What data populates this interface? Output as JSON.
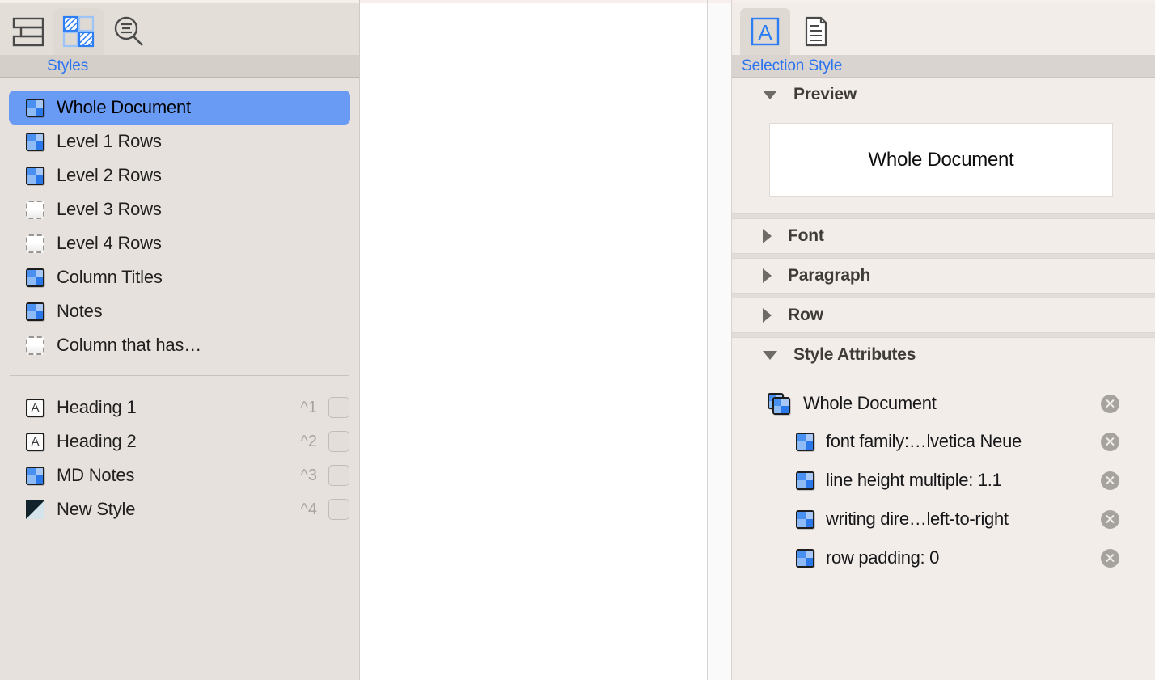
{
  "left_panel": {
    "toolbar": [
      {
        "icon": "table-layout-icon",
        "name": "layout-tab",
        "active": false
      },
      {
        "icon": "styles-checkerboard-icon",
        "name": "styles-tab",
        "active": true
      },
      {
        "icon": "search-document-icon",
        "name": "search-tab",
        "active": false
      }
    ],
    "tab_label": "Styles",
    "styles": [
      {
        "label": "Whole Document",
        "icon": "checkerboard-icon",
        "selected": true
      },
      {
        "label": "Level 1 Rows",
        "icon": "checkerboard-icon",
        "selected": false
      },
      {
        "label": "Level 2 Rows",
        "icon": "checkerboard-icon",
        "selected": false
      },
      {
        "label": "Level 3 Rows",
        "icon": "dashed-empty-icon",
        "selected": false
      },
      {
        "label": "Level 4 Rows",
        "icon": "dashed-empty-icon",
        "selected": false
      },
      {
        "label": "Column Titles",
        "icon": "checkerboard-icon",
        "selected": false
      },
      {
        "label": "Notes",
        "icon": "checkerboard-icon",
        "selected": false
      },
      {
        "label": "Column that has…",
        "icon": "dashed-empty-icon",
        "selected": false
      }
    ],
    "shortcuts": [
      {
        "label": "Heading 1",
        "key": "^1",
        "icon": "letter-a-icon"
      },
      {
        "label": "Heading 2",
        "key": "^2",
        "icon": "letter-a-icon"
      },
      {
        "label": "MD Notes",
        "key": "^3",
        "icon": "checkerboard-icon"
      },
      {
        "label": "New Style",
        "key": "^4",
        "icon": "diagonal-split-icon"
      }
    ]
  },
  "right_panel": {
    "toolbar": [
      {
        "icon": "letter-a-boxed-icon",
        "name": "selection-style-tab",
        "active": true
      },
      {
        "icon": "document-text-icon",
        "name": "document-style-tab",
        "active": false
      }
    ],
    "tab_label": "Selection Style",
    "sections": [
      {
        "title": "Preview",
        "expanded": true
      },
      {
        "title": "Font",
        "expanded": false
      },
      {
        "title": "Paragraph",
        "expanded": false
      },
      {
        "title": "Row",
        "expanded": false
      },
      {
        "title": "Style Attributes",
        "expanded": true
      }
    ],
    "preview_text": "Whole Document",
    "style_attributes": {
      "root_label": "Whole Document",
      "items": [
        {
          "label": "font family:…lvetica Neue"
        },
        {
          "label": "line height multiple: 1.1"
        },
        {
          "label": "writing dire…left-to-right"
        },
        {
          "label": "row padding: 0"
        }
      ]
    }
  },
  "colors": {
    "accent_blue": "#2a72f0",
    "selection_blue": "#6a9bf4",
    "left_panel_bg": "#e6e1dc",
    "right_panel_bg": "#f2ede9",
    "tabbar_bg": "#d4cfc9"
  }
}
